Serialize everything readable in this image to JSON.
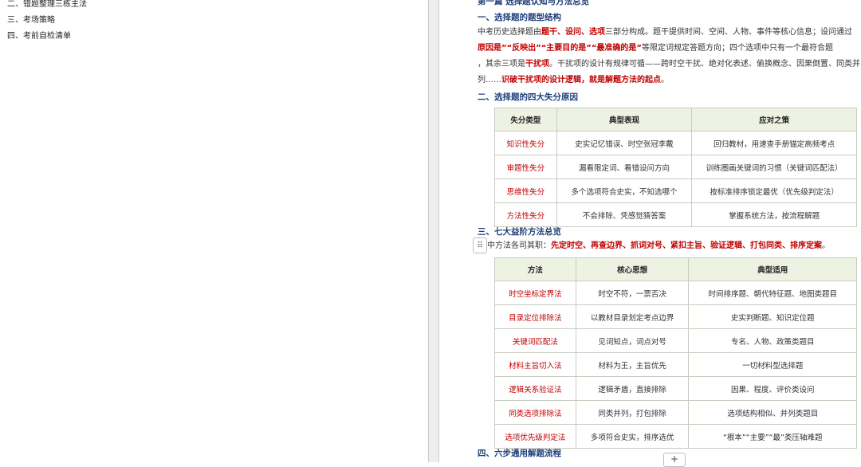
{
  "outline": {
    "items": [
      "二、错题整理三栋主法",
      "三、考场策略",
      "四、考前自检清单"
    ]
  },
  "document": {
    "top_heading": "第一篇 选择题认知与方法总览",
    "section1_title": "一、选择题的题型结构",
    "para1": {
      "line1_pre": "中考历史选择题由",
      "line1_red": "题干、设问、选项",
      "line1_post": "三部分构成。题干提供时间、空间、人物、事件等核心信息；设问通过",
      "line2_red1": "原因是”“反映出”“主要目的是”“最准确的是”",
      "line2_post": "等限定词规定答题方向；四个选项中只有一个最符合题",
      "line3_pre": "，其余三项是",
      "line3_red": "干扰项",
      "line3_post": "。干扰项的设计有规律可循——跨时空干扰、绝对化表述、偷换概念、因果倒置、同类并",
      "line4_pre": "列……",
      "line4_red": "识破干扰项的设计逻辑，就是解题方法的起点",
      "line4_post": "。"
    },
    "section2_title": "二、选择题的四大失分原因",
    "table1": {
      "headers": [
        "失分类型",
        "典型表现",
        "应对之策"
      ],
      "rows": [
        [
          "知识性失分",
          "史实记忆错误、时空张冠李戴",
          "回归教材，用速查手册锚定高频考点"
        ],
        [
          "审题性失分",
          "漏看限定词、看错设问方向",
          "训练圈画关键词的习惯（关键词匹配法）"
        ],
        [
          "思维性失分",
          "多个选项符合史实，不知选哪个",
          "按标准排序锁定最优（优先级判定法）"
        ],
        [
          "方法性失分",
          "不会排除、凭感觉猜答案",
          "掌握系统方法，按流程解题"
        ]
      ]
    },
    "section3_title": "三、七大益阶方法总览",
    "para2": {
      "pre": "中方法各司其职：",
      "red": "先定时空、再查边界、抓词对号、紧扣主旨、验证逻辑、打包同类、排序定案",
      "post": "。"
    },
    "table2": {
      "headers": [
        "方法",
        "核心思想",
        "典型适用"
      ],
      "rows": [
        [
          "时空坐标定界法",
          "时空不符，一票否决",
          "时间排序题、朝代特征题、地图类题目"
        ],
        [
          "目录定位排除法",
          "以教材目录划定考点边界",
          "史实判断题、知识定位题"
        ],
        [
          "关键词匹配法",
          "见词知点，词点对号",
          "专名、人物、政策类题目"
        ],
        [
          "材料主旨切入法",
          "材料为王，主旨优先",
          "一切材料型选择题"
        ],
        [
          "逻辑关系验证法",
          "逻辑矛盾，直接排除",
          "因果、程度、评价类设问"
        ],
        [
          "同类选项排除法",
          "同类并列，打包排除",
          "选项结构相似、并列类题目"
        ],
        [
          "选项优先级判定法",
          "多项符合史实，排序选优",
          "“根本”“主要”“最”类压轴难题"
        ]
      ]
    },
    "section4_title": "四、六步通用解题流程"
  },
  "controls": {
    "drag_handle_icon": "drag-handle-icon",
    "drag_handle_glyph": "⠿",
    "add_button_glyph": "+"
  }
}
